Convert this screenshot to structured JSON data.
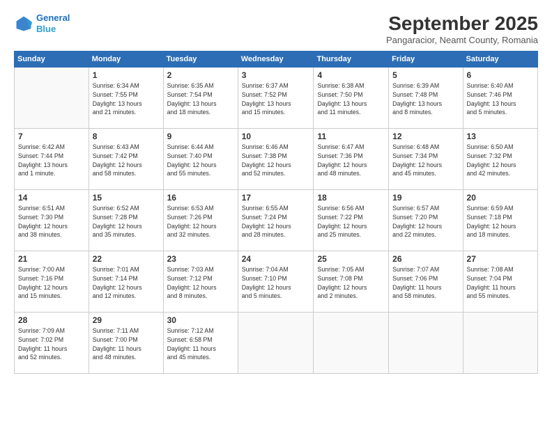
{
  "header": {
    "logo_line1": "General",
    "logo_line2": "Blue",
    "month": "September 2025",
    "location": "Pangaracior, Neamt County, Romania"
  },
  "days_of_week": [
    "Sunday",
    "Monday",
    "Tuesday",
    "Wednesday",
    "Thursday",
    "Friday",
    "Saturday"
  ],
  "weeks": [
    [
      {
        "day": "",
        "info": ""
      },
      {
        "day": "1",
        "info": "Sunrise: 6:34 AM\nSunset: 7:55 PM\nDaylight: 13 hours\nand 21 minutes."
      },
      {
        "day": "2",
        "info": "Sunrise: 6:35 AM\nSunset: 7:54 PM\nDaylight: 13 hours\nand 18 minutes."
      },
      {
        "day": "3",
        "info": "Sunrise: 6:37 AM\nSunset: 7:52 PM\nDaylight: 13 hours\nand 15 minutes."
      },
      {
        "day": "4",
        "info": "Sunrise: 6:38 AM\nSunset: 7:50 PM\nDaylight: 13 hours\nand 11 minutes."
      },
      {
        "day": "5",
        "info": "Sunrise: 6:39 AM\nSunset: 7:48 PM\nDaylight: 13 hours\nand 8 minutes."
      },
      {
        "day": "6",
        "info": "Sunrise: 6:40 AM\nSunset: 7:46 PM\nDaylight: 13 hours\nand 5 minutes."
      }
    ],
    [
      {
        "day": "7",
        "info": "Sunrise: 6:42 AM\nSunset: 7:44 PM\nDaylight: 13 hours\nand 1 minute."
      },
      {
        "day": "8",
        "info": "Sunrise: 6:43 AM\nSunset: 7:42 PM\nDaylight: 12 hours\nand 58 minutes."
      },
      {
        "day": "9",
        "info": "Sunrise: 6:44 AM\nSunset: 7:40 PM\nDaylight: 12 hours\nand 55 minutes."
      },
      {
        "day": "10",
        "info": "Sunrise: 6:46 AM\nSunset: 7:38 PM\nDaylight: 12 hours\nand 52 minutes."
      },
      {
        "day": "11",
        "info": "Sunrise: 6:47 AM\nSunset: 7:36 PM\nDaylight: 12 hours\nand 48 minutes."
      },
      {
        "day": "12",
        "info": "Sunrise: 6:48 AM\nSunset: 7:34 PM\nDaylight: 12 hours\nand 45 minutes."
      },
      {
        "day": "13",
        "info": "Sunrise: 6:50 AM\nSunset: 7:32 PM\nDaylight: 12 hours\nand 42 minutes."
      }
    ],
    [
      {
        "day": "14",
        "info": "Sunrise: 6:51 AM\nSunset: 7:30 PM\nDaylight: 12 hours\nand 38 minutes."
      },
      {
        "day": "15",
        "info": "Sunrise: 6:52 AM\nSunset: 7:28 PM\nDaylight: 12 hours\nand 35 minutes."
      },
      {
        "day": "16",
        "info": "Sunrise: 6:53 AM\nSunset: 7:26 PM\nDaylight: 12 hours\nand 32 minutes."
      },
      {
        "day": "17",
        "info": "Sunrise: 6:55 AM\nSunset: 7:24 PM\nDaylight: 12 hours\nand 28 minutes."
      },
      {
        "day": "18",
        "info": "Sunrise: 6:56 AM\nSunset: 7:22 PM\nDaylight: 12 hours\nand 25 minutes."
      },
      {
        "day": "19",
        "info": "Sunrise: 6:57 AM\nSunset: 7:20 PM\nDaylight: 12 hours\nand 22 minutes."
      },
      {
        "day": "20",
        "info": "Sunrise: 6:59 AM\nSunset: 7:18 PM\nDaylight: 12 hours\nand 18 minutes."
      }
    ],
    [
      {
        "day": "21",
        "info": "Sunrise: 7:00 AM\nSunset: 7:16 PM\nDaylight: 12 hours\nand 15 minutes."
      },
      {
        "day": "22",
        "info": "Sunrise: 7:01 AM\nSunset: 7:14 PM\nDaylight: 12 hours\nand 12 minutes."
      },
      {
        "day": "23",
        "info": "Sunrise: 7:03 AM\nSunset: 7:12 PM\nDaylight: 12 hours\nand 8 minutes."
      },
      {
        "day": "24",
        "info": "Sunrise: 7:04 AM\nSunset: 7:10 PM\nDaylight: 12 hours\nand 5 minutes."
      },
      {
        "day": "25",
        "info": "Sunrise: 7:05 AM\nSunset: 7:08 PM\nDaylight: 12 hours\nand 2 minutes."
      },
      {
        "day": "26",
        "info": "Sunrise: 7:07 AM\nSunset: 7:06 PM\nDaylight: 11 hours\nand 58 minutes."
      },
      {
        "day": "27",
        "info": "Sunrise: 7:08 AM\nSunset: 7:04 PM\nDaylight: 11 hours\nand 55 minutes."
      }
    ],
    [
      {
        "day": "28",
        "info": "Sunrise: 7:09 AM\nSunset: 7:02 PM\nDaylight: 11 hours\nand 52 minutes."
      },
      {
        "day": "29",
        "info": "Sunrise: 7:11 AM\nSunset: 7:00 PM\nDaylight: 11 hours\nand 48 minutes."
      },
      {
        "day": "30",
        "info": "Sunrise: 7:12 AM\nSunset: 6:58 PM\nDaylight: 11 hours\nand 45 minutes."
      },
      {
        "day": "",
        "info": ""
      },
      {
        "day": "",
        "info": ""
      },
      {
        "day": "",
        "info": ""
      },
      {
        "day": "",
        "info": ""
      }
    ]
  ]
}
